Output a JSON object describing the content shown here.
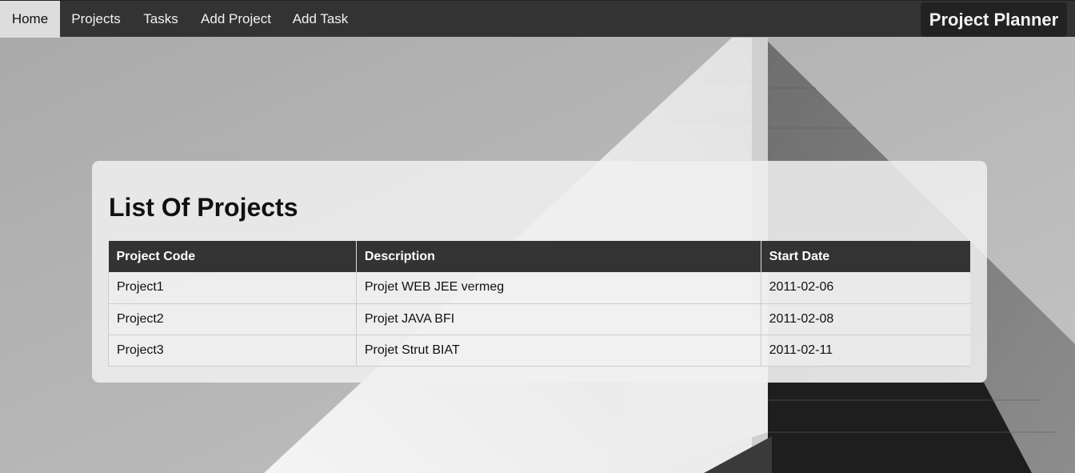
{
  "nav": {
    "items": [
      {
        "label": "Home",
        "active": true
      },
      {
        "label": "Projects",
        "active": false
      },
      {
        "label": "Tasks",
        "active": false
      },
      {
        "label": "Add Project",
        "active": false
      },
      {
        "label": "Add Task",
        "active": false
      }
    ],
    "brand": "Project Planner"
  },
  "main": {
    "heading": "List Of Projects",
    "table": {
      "headers": [
        "Project Code",
        "Description",
        "Start Date"
      ],
      "rows": [
        [
          "Project1",
          "Projet WEB JEE vermeg",
          "2011-02-06"
        ],
        [
          "Project2",
          "Projet JAVA BFI",
          "2011-02-08"
        ],
        [
          "Project3",
          "Projet Strut BIAT",
          "2011-02-11"
        ]
      ]
    }
  },
  "colors": {
    "nav_bg": "#333333",
    "nav_active_bg": "#dddddd",
    "brand_bg": "#222222",
    "table_header_bg": "#333333"
  }
}
